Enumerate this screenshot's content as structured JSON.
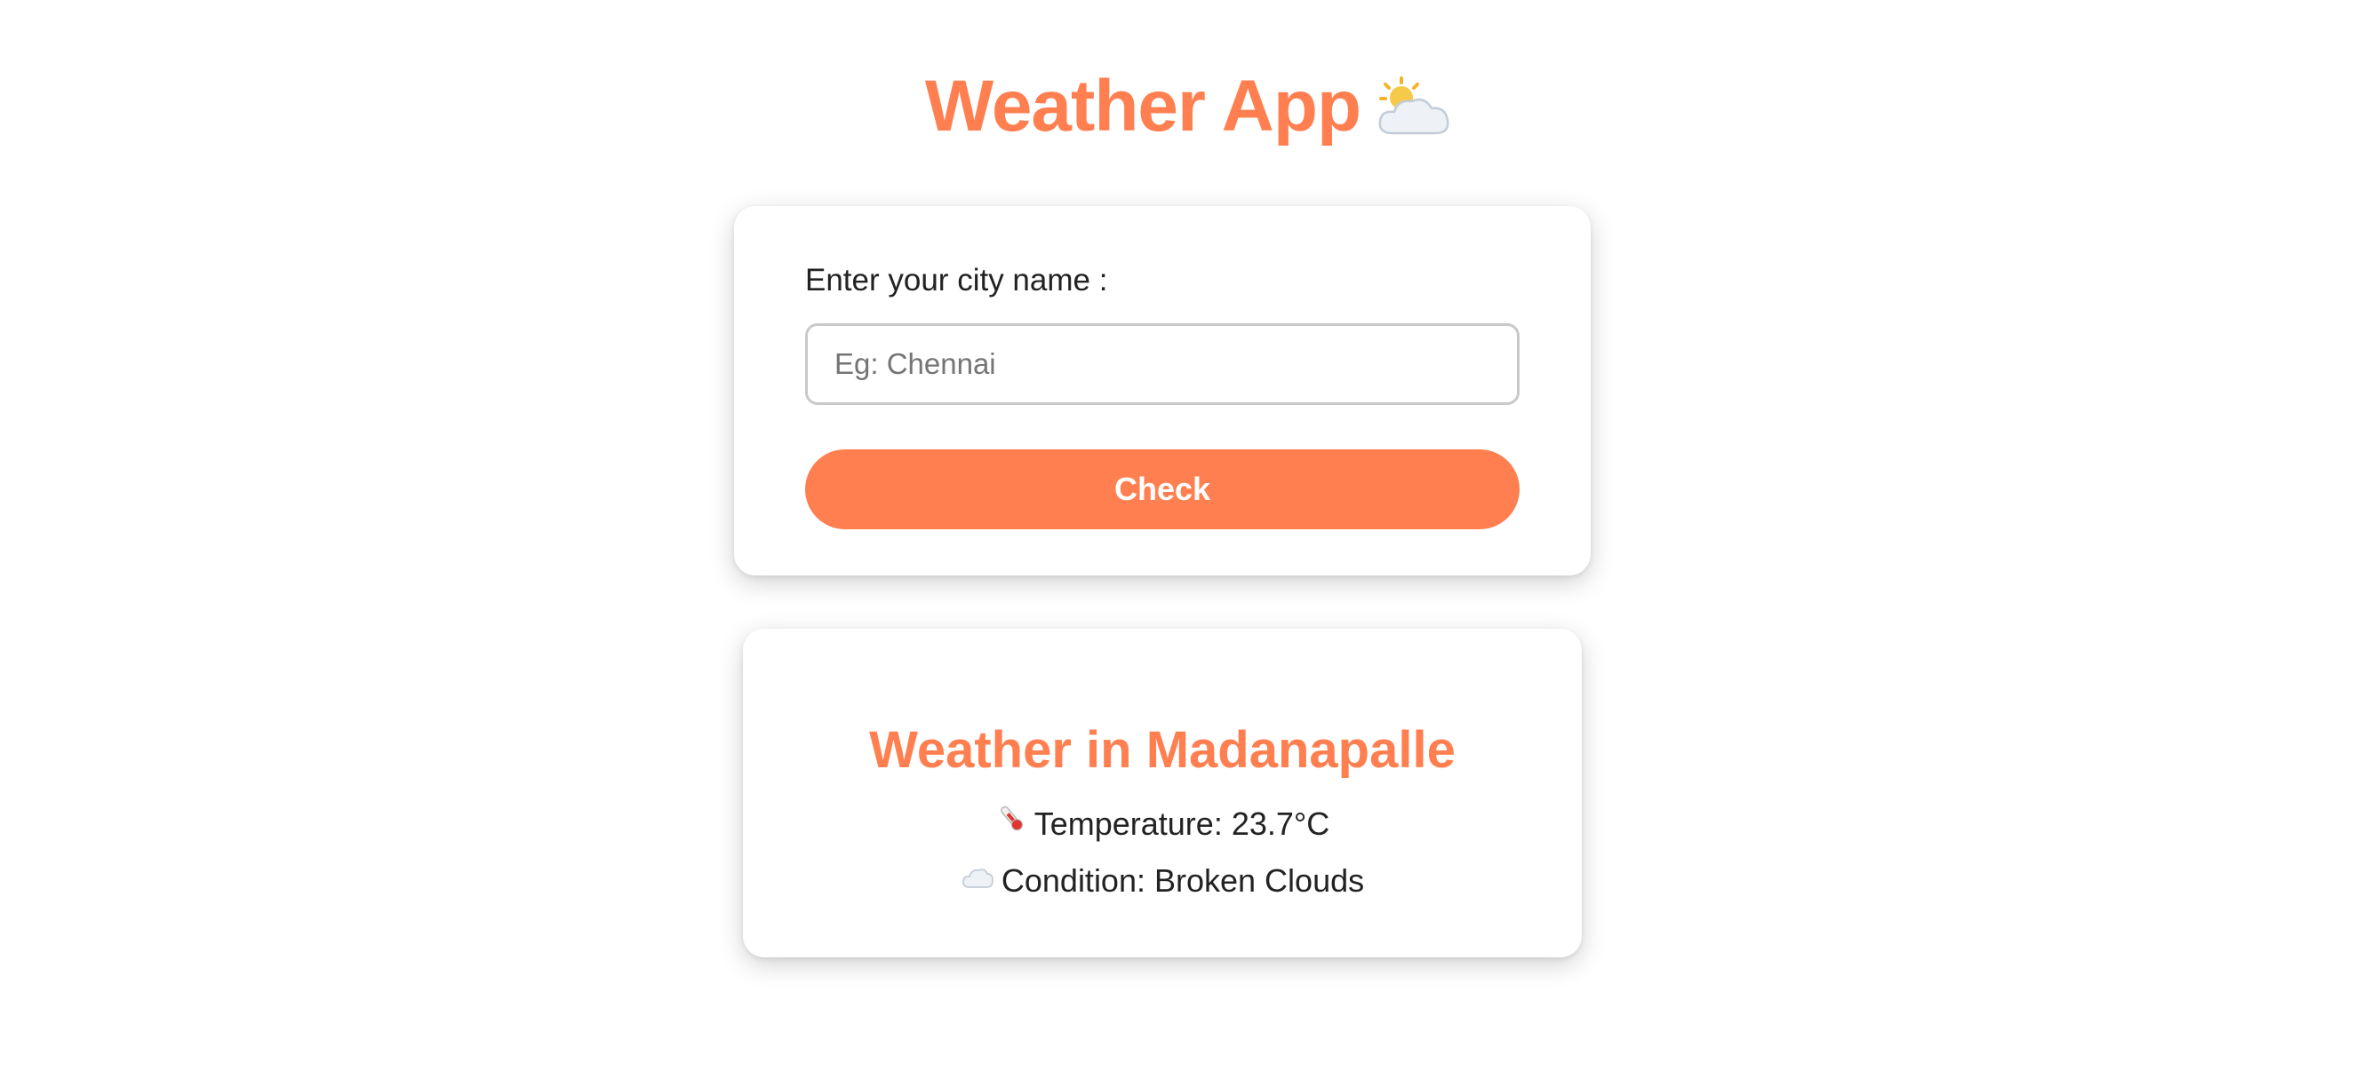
{
  "header": {
    "title": "Weather App",
    "icon": "sun-behind-cloud-icon"
  },
  "form": {
    "label": "Enter your city name :",
    "input_value": "",
    "input_placeholder": "Eg: Chennai",
    "button_label": "Check"
  },
  "result": {
    "title": "Weather in Madanapalle",
    "temperature_label": "Temperature: 23.7°C",
    "temperature_icon": "thermometer-icon",
    "condition_label": "Condition: Broken Clouds",
    "condition_icon": "cloud-icon"
  },
  "colors": {
    "accent": "#ff7f50",
    "text": "#222222",
    "background": "#ffffff"
  }
}
